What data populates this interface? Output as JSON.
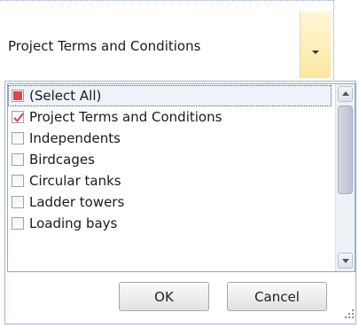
{
  "combo": {
    "value": "Project Terms and Conditions"
  },
  "list": {
    "items": [
      {
        "label": "(Select All)",
        "state": "partial",
        "selected": true
      },
      {
        "label": "Project Terms and Conditions",
        "state": "checked",
        "selected": false
      },
      {
        "label": "Independents",
        "state": "unchecked",
        "selected": false
      },
      {
        "label": "Birdcages",
        "state": "unchecked",
        "selected": false
      },
      {
        "label": "Circular tanks",
        "state": "unchecked",
        "selected": false
      },
      {
        "label": "Ladder towers",
        "state": "unchecked",
        "selected": false
      },
      {
        "label": "Loading bays",
        "state": "unchecked",
        "selected": false
      }
    ]
  },
  "buttons": {
    "ok": "OK",
    "cancel": "Cancel"
  },
  "colors": {
    "check": "#e0444c",
    "partial": "#e0444c",
    "dropdown_bg": "#fde8a0"
  }
}
